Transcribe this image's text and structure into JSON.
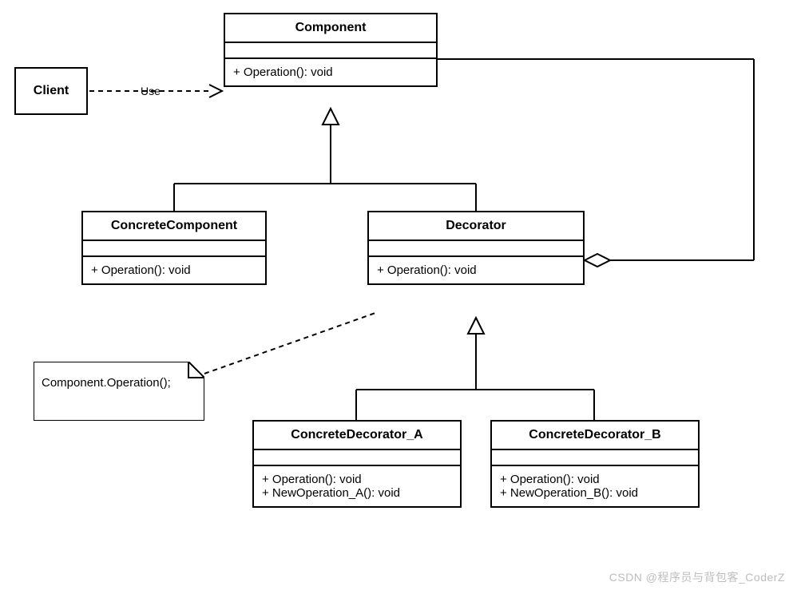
{
  "diagram": {
    "client": {
      "name": "Client"
    },
    "component": {
      "name": "Component",
      "ops": [
        "+ Operation(): void"
      ]
    },
    "concreteComponent": {
      "name": "ConcreteComponent",
      "ops": [
        "+ Operation(): void"
      ]
    },
    "decorator": {
      "name": "Decorator",
      "ops": [
        "+ Operation(): void"
      ]
    },
    "concreteDecoratorA": {
      "name": "ConcreteDecorator_A",
      "ops": [
        "+ Operation(): void",
        "+ NewOperation_A(): void"
      ]
    },
    "concreteDecoratorB": {
      "name": "ConcreteDecorator_B",
      "ops": [
        "+ Operation(): void",
        "+ NewOperation_B(): void"
      ]
    },
    "note": {
      "text": "Component.Operation();"
    },
    "relations": {
      "useLabel": "Use"
    }
  },
  "watermark": "CSDN @程序员与背包客_CoderZ"
}
